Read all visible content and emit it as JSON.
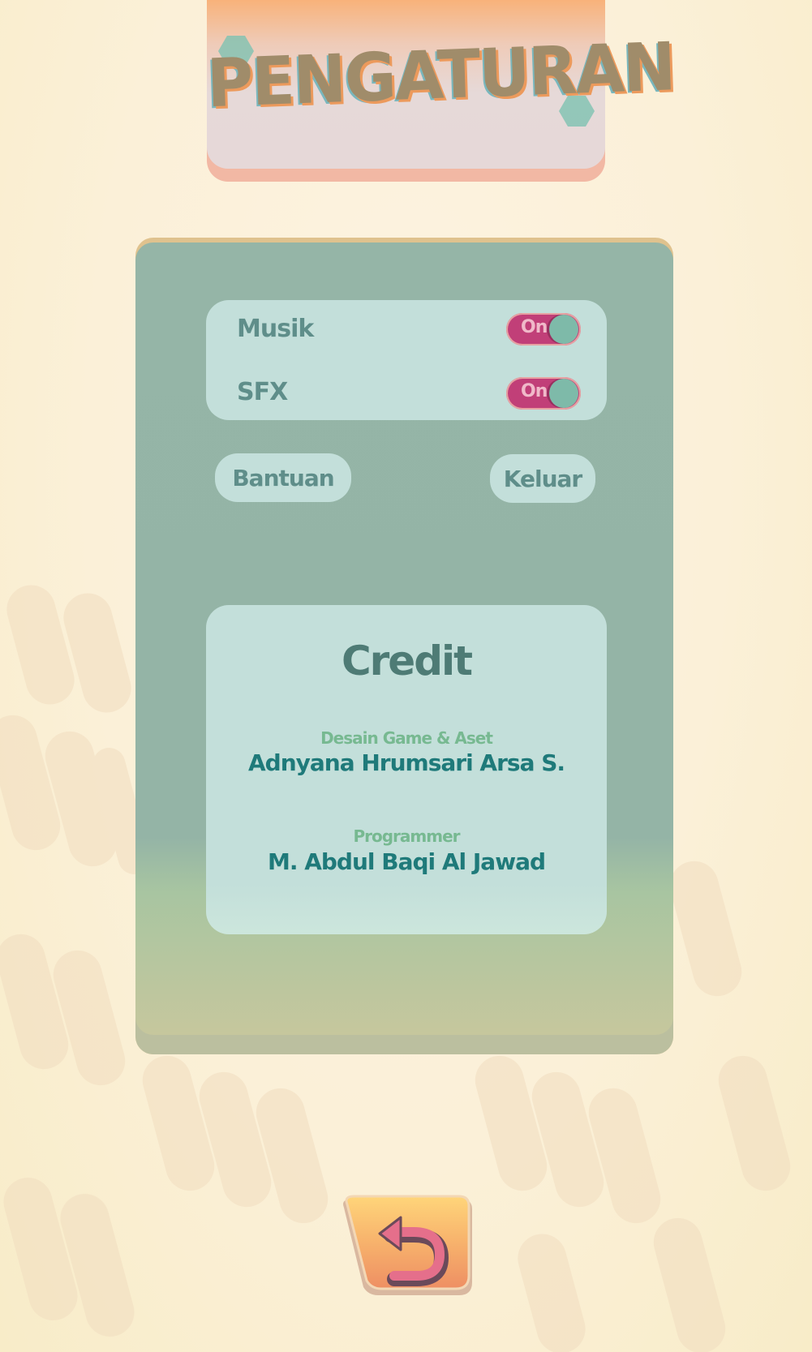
{
  "title": "PENGATURAN",
  "settings": {
    "music": {
      "label": "Musik",
      "state": "On"
    },
    "sfx": {
      "label": "SFX",
      "state": "On"
    }
  },
  "buttons": {
    "help": "Bantuan",
    "exit": "Keluar",
    "back_icon": "undo-arrow-icon"
  },
  "credit": {
    "heading": "Credit",
    "entries": [
      {
        "role": "Desain Game & Aset",
        "name": "Adnyana Hrumsari Arsa S."
      },
      {
        "role": "Programmer",
        "name": "M. Abdul Baqi Al Jawad"
      }
    ]
  },
  "colors": {
    "toggle_on": "#c13f78",
    "panel": "#95b5a7",
    "card": "#c3dfda",
    "accent_name": "#1f7a7a",
    "accent_role": "#77b991"
  }
}
